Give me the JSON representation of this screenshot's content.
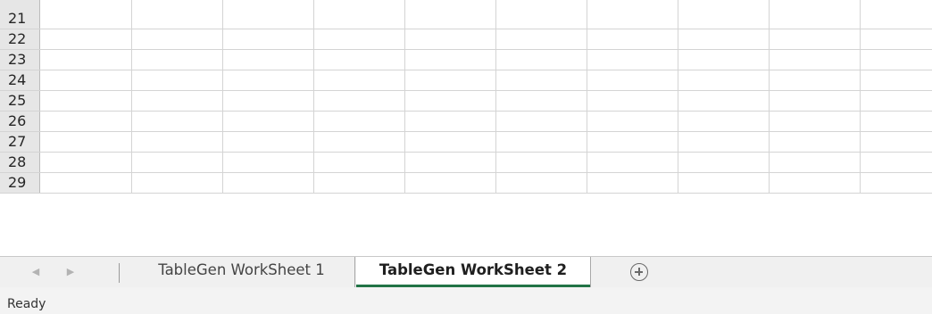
{
  "grid": {
    "row_numbers": [
      "21",
      "22",
      "23",
      "24",
      "25",
      "26",
      "27",
      "28",
      "29"
    ]
  },
  "sheet_tabs": {
    "prev_icon": "chevron-left-icon",
    "next_icon": "chevron-right-icon",
    "tabs": [
      {
        "label": "TableGen WorkSheet 1",
        "active": false
      },
      {
        "label": "TableGen WorkSheet 2",
        "active": true
      }
    ],
    "add_icon": "plus-circle-icon",
    "active_tab_color": "#217346"
  },
  "status_bar": {
    "status": "Ready"
  }
}
